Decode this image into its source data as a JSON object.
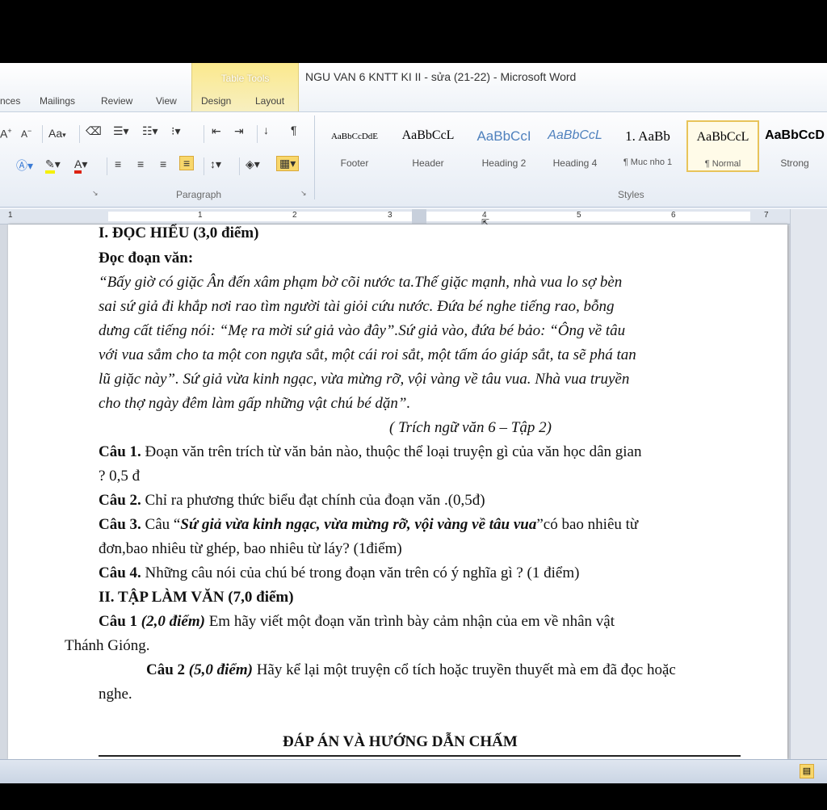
{
  "window": {
    "title": "NGU VAN 6 KNTT KI II - sửa (21-22) - Microsoft Word",
    "context_tab": "Table Tools"
  },
  "tabs": [
    "nces",
    "Mailings",
    "Review",
    "View",
    "Design",
    "Layout"
  ],
  "ribbon": {
    "font_buttons": [
      "A",
      "A",
      "Aa"
    ],
    "paragraph_group_label": "Paragraph",
    "styles_group_label": "Styles",
    "styles": [
      {
        "sample": "AaBbCcDdE",
        "name": "Footer",
        "selected": false
      },
      {
        "sample": "AaBbCcL",
        "name": "Header",
        "selected": false
      },
      {
        "sample": "AaBbCcI",
        "name": "Heading 2",
        "selected": false
      },
      {
        "sample": "AaBbCcL",
        "name": "Heading 4",
        "selected": false
      },
      {
        "sample": "1. AaBb",
        "name": "¶ Muc nho 1",
        "selected": false
      },
      {
        "sample": "AaBbCcL",
        "name": "¶ Normal",
        "selected": true
      },
      {
        "sample": "AaBbCcD",
        "name": "Strong",
        "selected": false
      }
    ]
  },
  "ruler": {
    "numbers": [
      "1",
      "1",
      "2",
      "3",
      "4",
      "5",
      "6",
      "7"
    ]
  },
  "document": {
    "l1": "I. ĐỌC HIỂU (3,0 điểm)",
    "l2": "Đọc đoạn văn:",
    "p1": "“Bấy giờ có giặc Ân đến xâm phạm bờ cõi nước ta.Thế giặc mạnh, nhà vua lo sợ bèn",
    "p2": "sai sứ giả đi khắp nơi rao tìm người tài giỏi cứu nước. Đứa bé nghe tiếng rao, bỗng",
    "p3": "dưng cất tiếng nói: “Mẹ ra mời sứ giả vào đây”.Sứ giả vào, đứa bé bảo: “Ông về tâu",
    "p4": "với vua sắm cho ta một con ngựa sắt, một cái roi sắt, một tấm áo giáp sắt, ta sẽ phá tan",
    "p5": "lũ giặc này”. Sứ giả vừa kinh ngạc, vừa mừng rỡ, vội vàng về tâu vua. Nhà vua truyền",
    "p6": "cho thợ ngày đêm làm gấp những vật chú bé dặn”.",
    "src": "( Trích ngữ văn 6 – Tập 2)",
    "q1_label": "Câu 1.",
    "q1_text": " Đoạn văn trên trích từ văn bản nào, thuộc thể loại truyện gì của văn học dân gian",
    "q1_cont": "? 0,5 đ",
    "q2_label": "Câu 2.",
    "q2_text": " Chỉ ra phương thức biểu đạt chính của đoạn văn .(0,5đ)",
    "q3_label": "Câu 3.",
    "q3_pre": " Câu “",
    "q3_quote": "Sứ giả vừa kinh ngạc, vừa mừng rỡ, vội vàng về tâu vua",
    "q3_post": "”có bao nhiêu từ",
    "q3_cont": "đơn,bao nhiêu từ ghép, bao nhiêu từ láy? (1điểm)",
    "q4_label": "Câu 4.",
    "q4_text": " Những câu nói của chú bé trong đoạn văn trên có ý nghĩa gì ? (1 điểm)",
    "s2": "II. TẬP LÀM VĂN (7,0 điểm)",
    "c1_label": "Câu 1",
    "c1_pts": " (2,0 điểm)",
    "c1_text": " Em hãy viết một đoạn văn trình bày cảm nhận của em về nhân vật",
    "c1_cont": "Thánh Gióng.",
    "c2_label": "Câu 2",
    "c2_pts": " (5,0 điểm)",
    "c2_text": " Hãy kể lại một truyện cổ tích hoặc truyền thuyết  mà em đã đọc hoặc",
    "c2_cont": "nghe.",
    "answer_heading": "ĐÁP ÁN VÀ HƯỚNG DẪN CHẤM"
  }
}
